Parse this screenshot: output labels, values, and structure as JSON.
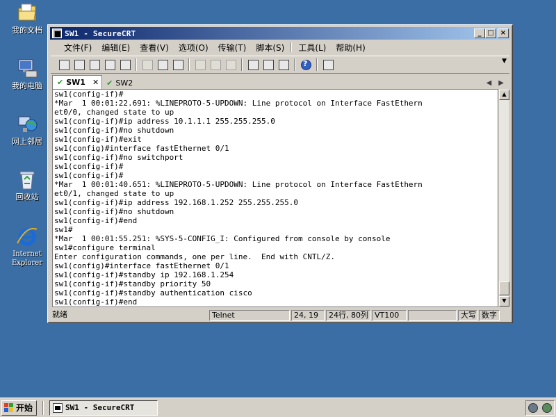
{
  "desktop": {
    "icons": [
      {
        "label": "我的文档"
      },
      {
        "label": "我的电脑"
      },
      {
        "label": "网上邻居"
      },
      {
        "label": "回收站"
      },
      {
        "label": "Internet"
      },
      {
        "label": "Explorer"
      }
    ]
  },
  "window": {
    "title": "SW1 - SecureCRT",
    "buttons": {
      "minimize": "_",
      "maximize": "□",
      "close": "×"
    }
  },
  "menu": [
    "文件(F)",
    "编辑(E)",
    "查看(V)",
    "选项(O)",
    "传输(T)",
    "脚本(S)",
    "工具(L)",
    "帮助(H)"
  ],
  "tabs": [
    {
      "label": "SW1",
      "close": "✕",
      "active": true
    },
    {
      "label": "SW2",
      "active": false
    }
  ],
  "terminal": {
    "lines": [
      "sw1(config-if)#",
      "*Mar  1 00:01:22.691: %LINEPROTO-5-UPDOWN: Line protocol on Interface FastEthern",
      "et0/0, changed state to up",
      "sw1(config-if)#ip address 10.1.1.1 255.255.255.0",
      "sw1(config-if)#no shutdown",
      "sw1(config-if)#exit",
      "sw1(config)#interface fastEthernet 0/1",
      "sw1(config-if)#no switchport",
      "sw1(config-if)#",
      "sw1(config-if)#",
      "*Mar  1 00:01:40.651: %LINEPROTO-5-UPDOWN: Line protocol on Interface FastEthern",
      "et0/1, changed state to up",
      "sw1(config-if)#ip address 192.168.1.252 255.255.255.0",
      "sw1(config-if)#no shutdown",
      "sw1(config-if)#end",
      "sw1#",
      "*Mar  1 00:01:55.251: %SYS-5-CONFIG_I: Configured from console by console",
      "sw1#configure terminal",
      "Enter configuration commands, one per line.  End with CNTL/Z.",
      "sw1(config)#interface fastEthernet 0/1",
      "sw1(config-if)#standby ip 192.168.1.254",
      "sw1(config-if)#standby priority 50",
      "sw1(config-if)#standby authentication cisco",
      "sw1(config-if)#end"
    ]
  },
  "status": {
    "ready": "就绪",
    "protocol": "Telnet",
    "cursor": "24, 19",
    "size": "24行, 80列",
    "emulation": "VT100",
    "caps": "大写",
    "num": "数字"
  },
  "taskbar": {
    "start": "开始",
    "task": "SW1 - SecureCRT"
  },
  "colors": {
    "desktop": "#3a6ea5",
    "title_active_start": "#0a246a",
    "title_active_end": "#a6caf0",
    "chrome": "#d4d0c8"
  }
}
